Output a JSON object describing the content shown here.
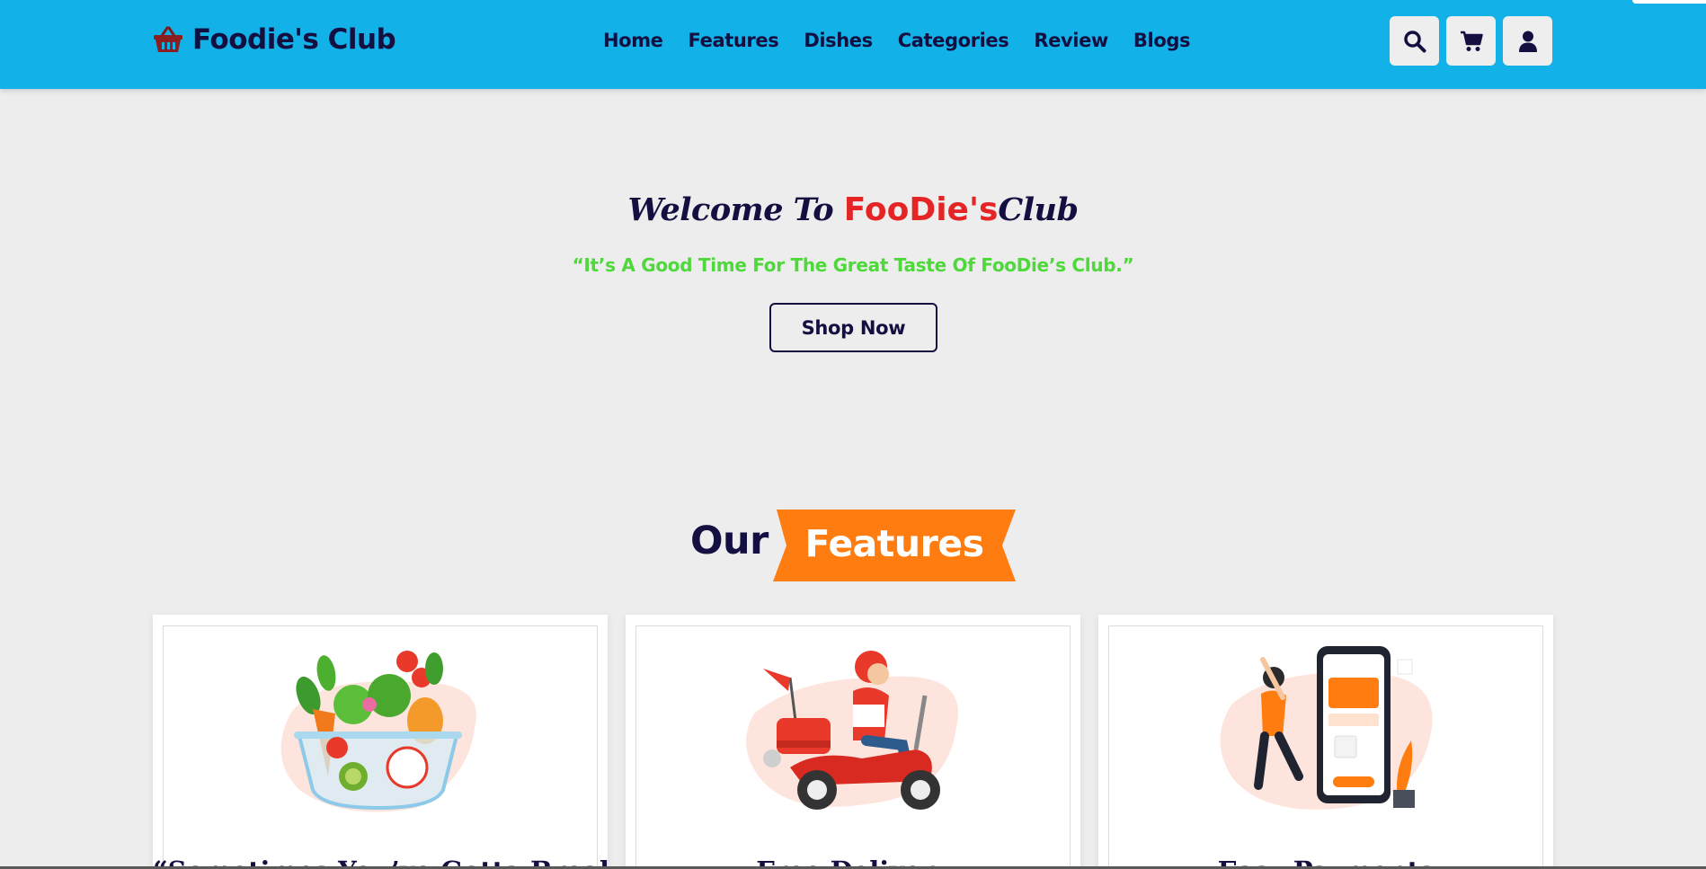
{
  "header": {
    "logo_text": "Foodie's Club",
    "nav": [
      "Home",
      "Features",
      "Dishes",
      "Categories",
      "Review",
      "Blogs"
    ],
    "icons": [
      "search-icon",
      "cart-icon",
      "user-icon"
    ]
  },
  "hero": {
    "welcome_prefix": "Welcome To ",
    "brand": "FooDie's",
    "welcome_suffix": "Club",
    "tagline": "“It’s A Good Time For The Great Taste Of FooDie’s Club.”",
    "cta": "Shop Now"
  },
  "features": {
    "heading_plain": "Our",
    "heading_highlight": "Features",
    "cards": [
      {
        "title": "“Sometimes You’ve Gotta Break",
        "art": "salad-bowl-illustration"
      },
      {
        "title": "Free Delivery",
        "art": "delivery-scooter-illustration"
      },
      {
        "title": "Easy Payments",
        "art": "mobile-payment-illustration"
      }
    ]
  },
  "colors": {
    "navbar": "#12b1e8",
    "text": "#130f40",
    "brand_red": "#e52525",
    "tagline_green": "#4fd83b",
    "banner_orange": "#ff7c10",
    "page_bg": "#ededed"
  }
}
